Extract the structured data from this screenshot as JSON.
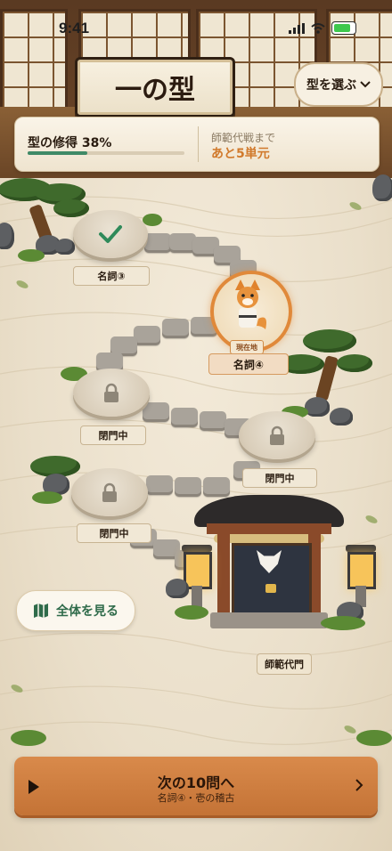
{
  "status_bar": {
    "time": "9:41"
  },
  "header": {
    "title": "一の型",
    "select_button_label": "型を選ぶ",
    "select_icon": "chevron-down-icon"
  },
  "progress": {
    "label": "型の修得 38%",
    "fraction": 0.38,
    "next_exam_label": "師範代戦まで",
    "next_exam_value": "あと5単元"
  },
  "map": {
    "nodes": [
      {
        "label": "名詞③",
        "state": "completed",
        "icon": "checkmark-icon"
      },
      {
        "label": "名詞④",
        "state": "current",
        "tag": "現在地"
      },
      {
        "label": "閉門中",
        "state": "locked",
        "icon": "lock-icon"
      },
      {
        "label": "閉門中",
        "state": "locked",
        "icon": "lock-icon"
      },
      {
        "label": "閉門中",
        "state": "locked",
        "icon": "lock-icon"
      }
    ],
    "boss_gate_label": "師範代門"
  },
  "overview_button": {
    "label": "全体を見る",
    "icon": "map-icon"
  },
  "next_button": {
    "label": "次の10問へ",
    "sublabel": "名詞④・壱の稽古",
    "icon": "play-icon",
    "trailing_icon": "chevron-right-icon"
  },
  "colors": {
    "accent_orange": "#d17a2c",
    "progress_green": "#3f8a67",
    "sand": "#eadfca"
  }
}
